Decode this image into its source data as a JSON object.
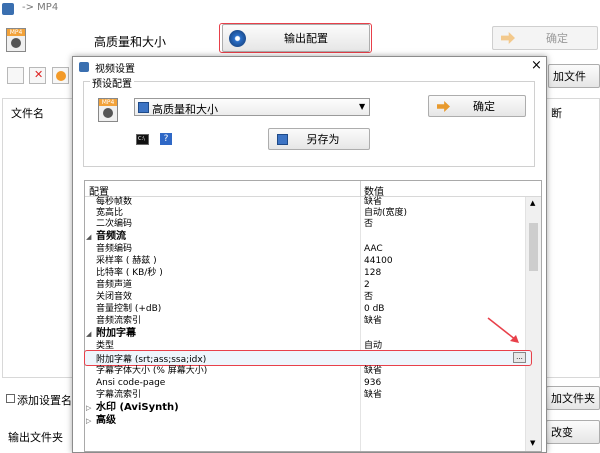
{
  "main": {
    "title_fragment": "-> MP4",
    "preset_label": "高质量和大小",
    "output_config_button": "输出配置",
    "ok_button": "确定",
    "add_file_button": "加文件",
    "file_name_header": "文件名",
    "right_header_fragment": "断",
    "add_setting_name_checkbox": "添加设置名称",
    "add_folder_button": "加文件夹",
    "output_folder_label": "输出文件夹",
    "change_button": "改变"
  },
  "dialog": {
    "title": "视频设置",
    "close": "×",
    "preset_group": "预设配置",
    "preset_selected": "高质量和大小",
    "ok_button": "确定",
    "save_as_button": "另存为",
    "table_header_config": "配置",
    "table_header_value": "数值",
    "rows": [
      {
        "name": "每秒帧数",
        "value": "缺省"
      },
      {
        "name": "宽高比",
        "value": "自动(宽度)"
      },
      {
        "name": "二次编码",
        "value": "否"
      }
    ],
    "audio_category": "音频流",
    "audio_rows": [
      {
        "name": "音频编码",
        "value": "AAC"
      },
      {
        "name": "采样率 ( 赫兹 )",
        "value": "44100"
      },
      {
        "name": "比特率 ( KB/秒 )",
        "value": "128"
      },
      {
        "name": "音频声道",
        "value": "2"
      },
      {
        "name": "关闭音效",
        "value": "否"
      },
      {
        "name": "音量控制 (+dB)",
        "value": "0 dB"
      },
      {
        "name": "音频流索引",
        "value": "缺省"
      }
    ],
    "subtitle_category": "附加字幕",
    "subtitle_rows": [
      {
        "name": "类型",
        "value": "自动"
      },
      {
        "name": "附加字幕 (srt;ass;ssa;idx)",
        "value": ""
      },
      {
        "name": "字幕字体大小 (% 屏幕大小)",
        "value": "缺省"
      },
      {
        "name": "Ansi code-page",
        "value": "936"
      },
      {
        "name": "字幕流索引",
        "value": "缺省"
      }
    ],
    "watermark_category": "水印 (AviSynth)",
    "advanced_category": "高级",
    "browse_button": "..."
  },
  "colors": {
    "highlight_red": "#e8404a",
    "dialog_title_bg": "#ffffff",
    "grid_line": "#e4e4e4",
    "selection_bg": "#cce4f7"
  },
  "icons": [
    "app-icon",
    "mp4-file-icon",
    "settings-disc-icon",
    "arrow-right-icon",
    "save-disk-icon",
    "console-icon",
    "help-icon",
    "collapse-triangle-icon",
    "expand-triangle-icon",
    "scroll-up-icon",
    "scroll-down-icon"
  ]
}
